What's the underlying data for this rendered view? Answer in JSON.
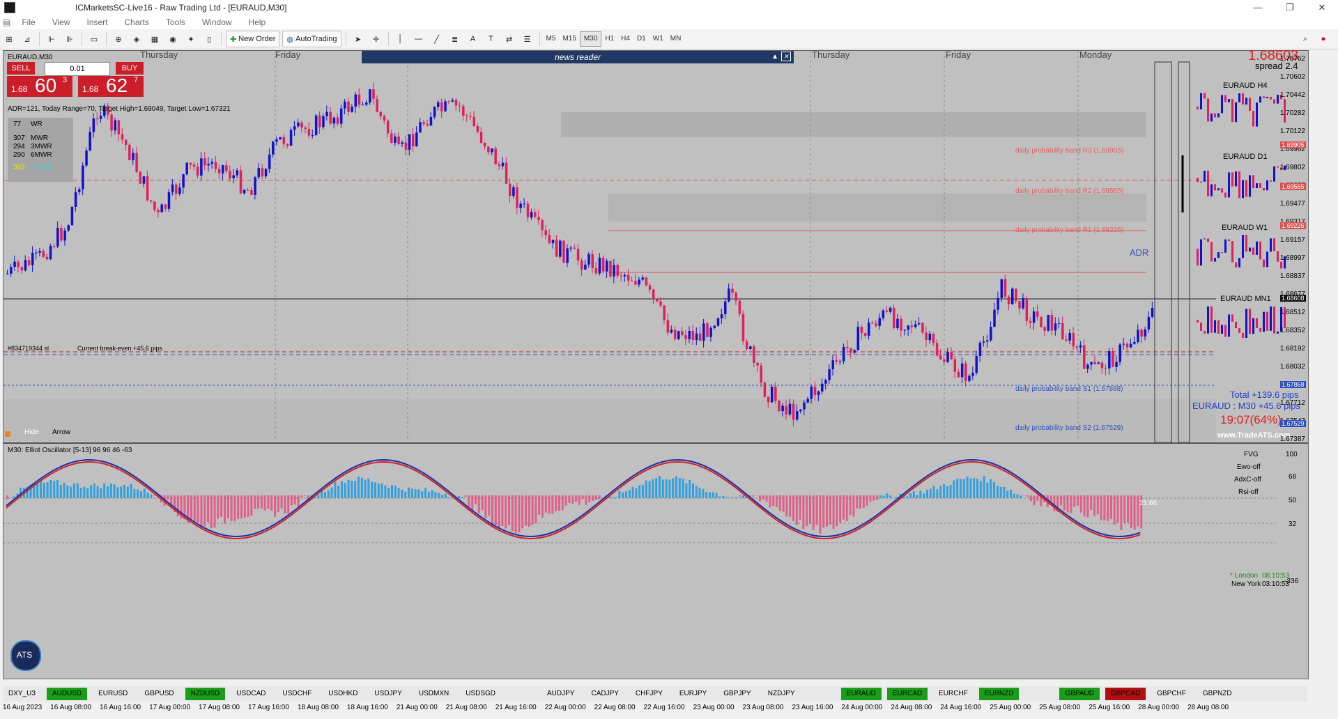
{
  "window": {
    "title": "ICMarketsSC-Live16 - Raw Trading Ltd - [EURAUD,M30]",
    "controls": [
      "—",
      "❐",
      "✕"
    ]
  },
  "menu": [
    "File",
    "View",
    "Insert",
    "Charts",
    "Tools",
    "Window",
    "Help"
  ],
  "toolbar": {
    "new_order": "New Order",
    "auto_trading": "AutoTrading",
    "timeframes": [
      "M5",
      "M15",
      "M30",
      "H1",
      "H4",
      "D1",
      "W1",
      "MN"
    ],
    "selected_timeframe": "M30"
  },
  "chart": {
    "symbol": "EURAUD,M30",
    "sell_label": "SELL",
    "buy_label": "BUY",
    "lot": "0.01",
    "sell_small": "1.68",
    "sell_big": "60",
    "sell_sup": "3",
    "buy_small": "1.68",
    "buy_big": "62",
    "buy_sup": "7",
    "adr_line": "ADR=121, Today Range=70, Target High=1.69049, Target Low=1.67321",
    "wr": [
      {
        "v": "77",
        "l": "WR"
      },
      {
        "v": "307",
        "l": "MWR"
      },
      {
        "v": "294",
        "l": "3MWR"
      },
      {
        "v": "290",
        "l": "6MWR"
      },
      {
        "v": "363",
        "l": "3xADR"
      }
    ],
    "news_reader": "news reader",
    "day_labels": [
      "Thursday",
      "Friday",
      "Thursday",
      "Friday",
      "Monday"
    ],
    "current_price": "1.68603",
    "spread": "spread 2.4",
    "mini_charts": [
      "EURAUD H4",
      "EURAUD D1",
      "EURAUD W1",
      "EURAUD MN1"
    ],
    "bands": [
      "daily probability band R3 (1.69905)",
      "daily probability band R2 (1.69565)",
      "daily probability band R1 (1.69226)",
      "daily probability band S1 (1.67868)",
      "daily probability band S2 (1.67529)"
    ],
    "adr_tag": "ADR",
    "position_line": "#834719344 sl",
    "breakeven": "Current break-even +45.6 pips",
    "total_pips": "Total +139.6 pips",
    "euraud_pips": "EURAUD : M30 +45.6 pips",
    "timer": "19:07(64%)",
    "website": "www.TradeATS.com",
    "hide": "Hide",
    "arrow": "Arrow",
    "price_axis": [
      "1.70762",
      "1.70602",
      "1.70442",
      "1.70282",
      "1.70122",
      "1.69962",
      "1.69802",
      "1.69637",
      "1.69477",
      "1.69317",
      "1.69157",
      "1.68997",
      "1.68837",
      "1.68677",
      "1.68512",
      "1.68352",
      "1.68192",
      "1.68032",
      "1.67872",
      "1.67712",
      "1.67547",
      "1.67387"
    ],
    "axis_tags": [
      "1.69905",
      "1.69565",
      "1.69226",
      "1.68608",
      "1.67868",
      "1.67529"
    ]
  },
  "oscillator": {
    "title": "M30: Elliot Oscillator [5-13]  96 96 46 -63",
    "side_labels": [
      "FVG",
      "Ewo-off",
      "AdxC-off",
      "Rsi-off"
    ],
    "levels": [
      "100",
      "68",
      "50",
      "32",
      "-336"
    ],
    "value_tag": "21.66",
    "london": "* London",
    "london_time": "08:10:53",
    "newyork": "New York",
    "newyork_time": "03:10:53"
  },
  "symbol_bar": [
    {
      "s": "DXY_U3",
      "c": ""
    },
    {
      "s": "AUDUSD",
      "c": "g"
    },
    {
      "s": "EURUSD",
      "c": ""
    },
    {
      "s": "GBPUSD",
      "c": ""
    },
    {
      "s": "NZDUSD",
      "c": "g"
    },
    {
      "s": "USDCAD",
      "c": ""
    },
    {
      "s": "USDCHF",
      "c": ""
    },
    {
      "s": "USDHKD",
      "c": ""
    },
    {
      "s": "USDJPY",
      "c": ""
    },
    {
      "s": "USDMXN",
      "c": ""
    },
    {
      "s": "USDSGD",
      "c": ""
    },
    {
      "s": "AUDJPY",
      "c": ""
    },
    {
      "s": "CADJPY",
      "c": ""
    },
    {
      "s": "CHFJPY",
      "c": ""
    },
    {
      "s": "EURJPY",
      "c": ""
    },
    {
      "s": "GBPJPY",
      "c": ""
    },
    {
      "s": "NZDJPY",
      "c": ""
    },
    {
      "s": "EURAUD",
      "c": "g"
    },
    {
      "s": "EURCAD",
      "c": "g"
    },
    {
      "s": "EURCHF",
      "c": ""
    },
    {
      "s": "EURNZD",
      "c": "g"
    },
    {
      "s": "GBPAUD",
      "c": "g"
    },
    {
      "s": "GBPCAD",
      "c": "r"
    },
    {
      "s": "GBPCHF",
      "c": ""
    },
    {
      "s": "GBPNZD",
      "c": ""
    }
  ],
  "dates": [
    "16 Aug 2023",
    "16 Aug 08:00",
    "16 Aug 16:00",
    "17 Aug 00:00",
    "17 Aug 08:00",
    "17 Aug 16:00",
    "18 Aug 08:00",
    "18 Aug 16:00",
    "21 Aug 00:00",
    "21 Aug 08:00",
    "21 Aug 16:00",
    "22 Aug 00:00",
    "22 Aug 08:00",
    "22 Aug 16:00",
    "23 Aug 00:00",
    "23 Aug 08:00",
    "23 Aug 16:00",
    "24 Aug 00:00",
    "24 Aug 08:00",
    "24 Aug 16:00",
    "25 Aug 00:00",
    "25 Aug 08:00",
    "25 Aug 16:00",
    "28 Aug 00:00",
    "28 Aug 08:00"
  ]
}
